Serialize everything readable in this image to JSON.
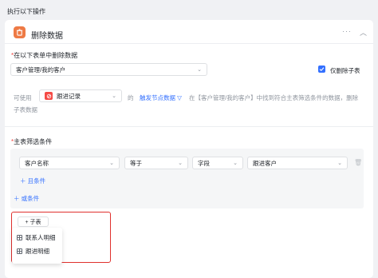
{
  "section_header": "执行以下操作",
  "action": {
    "title": "删除数据",
    "more_icon": "more-icon",
    "collapse_icon": "chevron-up-icon",
    "accent_color": "#ee7a45"
  },
  "table_select": {
    "label": "在以下表单中删除数据",
    "required_mark": "*",
    "value": "客户管理/我的客户",
    "only_subtable_label": "仅删除子表",
    "only_subtable_checked": true
  },
  "description": {
    "prefix": "可使用",
    "record_value": "跟进记录",
    "of": "的",
    "trigger_link": "触发节点数据",
    "text_line1": "在【客户管理/我的客户】中找到符合主表筛选条件的数据，删除",
    "text_line2": "子表数据"
  },
  "filter": {
    "label": "主表筛选条件",
    "required_mark": "*",
    "field": "客户名称",
    "operator": "等于",
    "value_type": "字段",
    "value": "跟进客户",
    "and_condition": "且条件",
    "or_condition": "或条件"
  },
  "subtable": {
    "add_button": "+ 子表",
    "options": [
      "联系人明细",
      "跟进明细"
    ]
  },
  "colors": {
    "primary": "#3370ff",
    "highlight_border": "#e0302d",
    "required": "#f54a45"
  }
}
